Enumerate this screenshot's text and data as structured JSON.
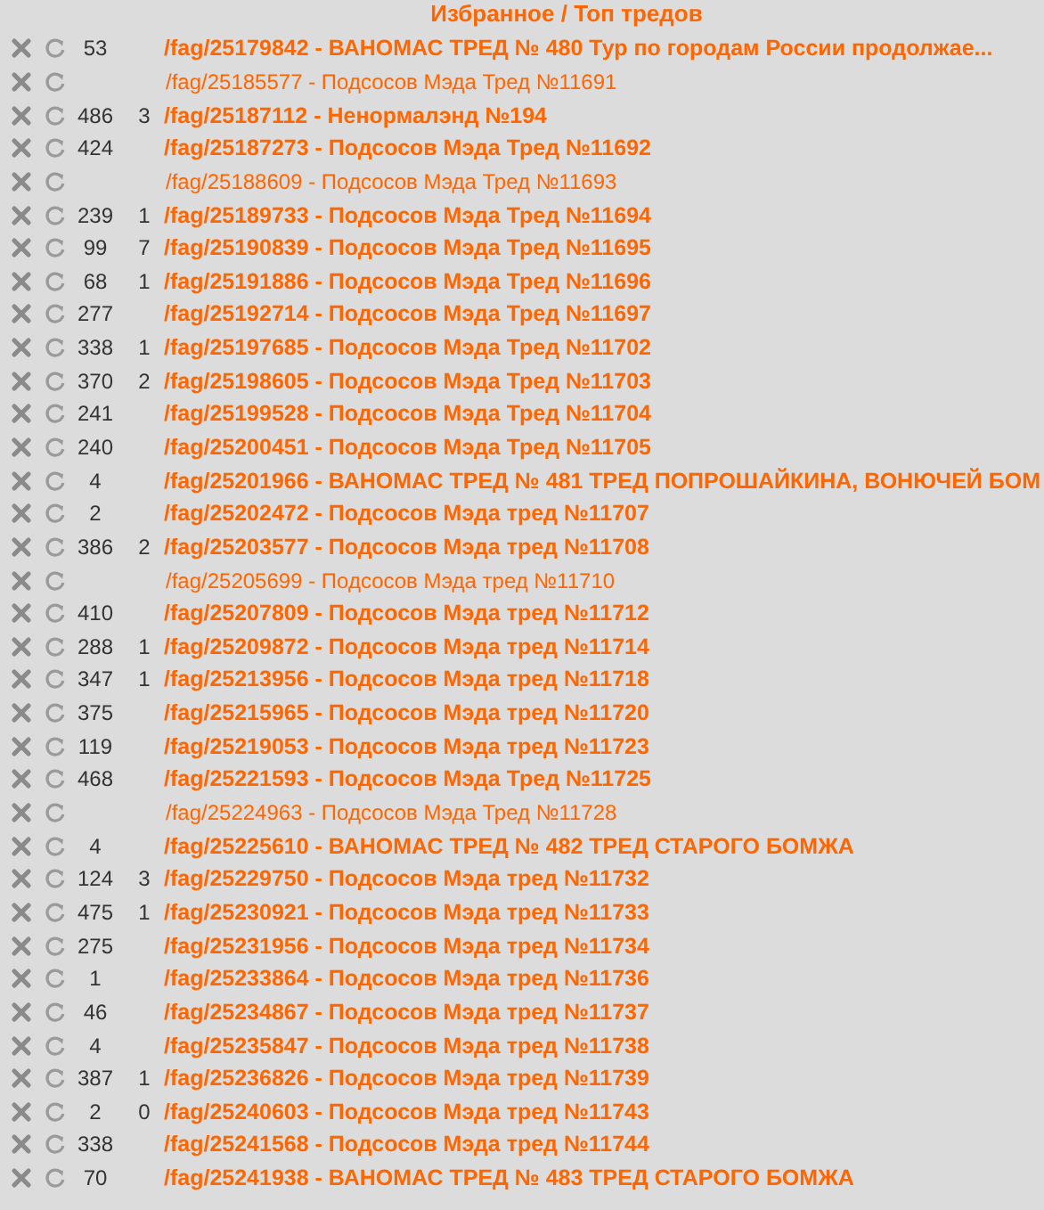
{
  "header": {
    "title": "Избранное / Топ тредов"
  },
  "threads": [
    {
      "kind": "live",
      "posts": "53",
      "link": "/fag/25179842 - ВАНОМАС ТРЕД № 480 Тур по городам России продолжае..."
    },
    {
      "kind": "dead",
      "link": "/fag/25185577 - Подсосов Мэда Тред №11691"
    },
    {
      "kind": "live",
      "posts": "486",
      "new": "3",
      "link": "/fag/25187112 - Ненормалэнд №194"
    },
    {
      "kind": "live",
      "posts": "424",
      "link": "/fag/25187273 - Подсосов Мэда Тред №11692"
    },
    {
      "kind": "dead",
      "link": "/fag/25188609 - Подсосов Мэда Тред №11693"
    },
    {
      "kind": "live",
      "posts": "239",
      "new": "1",
      "link": "/fag/25189733 - Подсосов Мэда Тред №11694"
    },
    {
      "kind": "live",
      "posts": "99",
      "new": "7",
      "link": "/fag/25190839 - Подсосов Мэда Тред №11695"
    },
    {
      "kind": "live",
      "posts": "68",
      "new": "1",
      "link": "/fag/25191886 - Подсосов Мэда Тред №11696"
    },
    {
      "kind": "live",
      "posts": "277",
      "link": "/fag/25192714 - Подсосов Мэда Тред №11697"
    },
    {
      "kind": "live",
      "posts": "338",
      "new": "1",
      "link": "/fag/25197685 - Подсосов Мэда Тред №11702"
    },
    {
      "kind": "live",
      "posts": "370",
      "new": "2",
      "link": "/fag/25198605 - Подсосов Мэда Тред №11703"
    },
    {
      "kind": "live",
      "posts": "241",
      "link": "/fag/25199528 - Подсосов Мэда Тред №11704"
    },
    {
      "kind": "live",
      "posts": "240",
      "link": "/fag/25200451 - Подсосов Мэда Тред №11705"
    },
    {
      "kind": "live",
      "posts": "4",
      "link": "/fag/25201966 - ВАНОМАС ТРЕД № 481 ТРЕД ПОПРОШАЙКИНА, ВОНЮЧЕЙ БОМ"
    },
    {
      "kind": "live",
      "posts": "2",
      "link": "/fag/25202472 - Подсосов Мэда тред №11707"
    },
    {
      "kind": "live",
      "posts": "386",
      "new": "2",
      "link": "/fag/25203577 - Подсосов Мэда тред №11708"
    },
    {
      "kind": "dead",
      "link": "/fag/25205699 - Подсосов Мэда тред №11710"
    },
    {
      "kind": "live",
      "posts": "410",
      "link": "/fag/25207809 - Подсосов Мэда тред №11712"
    },
    {
      "kind": "live",
      "posts": "288",
      "new": "1",
      "link": "/fag/25209872 - Подсосов Мэда тред №11714"
    },
    {
      "kind": "live",
      "posts": "347",
      "new": "1",
      "link": "/fag/25213956 - Подсосов Мэда тред №11718"
    },
    {
      "kind": "live",
      "posts": "375",
      "link": "/fag/25215965 - Подсосов Мэда тред №11720"
    },
    {
      "kind": "live",
      "posts": "119",
      "link": "/fag/25219053 - Подсосов Мэда тред №11723"
    },
    {
      "kind": "live",
      "posts": "468",
      "link": "/fag/25221593 - Подсосов Мэда Тред №11725"
    },
    {
      "kind": "dead",
      "link": "/fag/25224963 - Подсосов Мэда Тред №11728"
    },
    {
      "kind": "live",
      "posts": "4",
      "link": "/fag/25225610 - ВАНОМАС ТРЕД № 482 ТРЕД СТАРОГО БОМЖА"
    },
    {
      "kind": "live",
      "posts": "124",
      "new": "3",
      "link": "/fag/25229750 - Подсосов Мэда тред №11732"
    },
    {
      "kind": "live",
      "posts": "475",
      "new": "1",
      "link": "/fag/25230921 - Подсосов Мэда тред №11733"
    },
    {
      "kind": "live",
      "posts": "275",
      "link": "/fag/25231956 - Подсосов Мэда тред №11734"
    },
    {
      "kind": "live",
      "posts": "1",
      "link": "/fag/25233864 - Подсосов Мэда тред №11736"
    },
    {
      "kind": "live",
      "posts": "46",
      "link": "/fag/25234867 - Подсосов Мэда тред №11737"
    },
    {
      "kind": "live",
      "posts": "4",
      "link": "/fag/25235847 - Подсосов Мэда тред №11738"
    },
    {
      "kind": "live",
      "posts": "387",
      "new": "1",
      "link": "/fag/25236826 - Подсосов Мэда тред №11739"
    },
    {
      "kind": "live",
      "posts": "2",
      "new": "0",
      "link": "/fag/25240603 - Подсосов Мэда тред №11743"
    },
    {
      "kind": "live",
      "posts": "338",
      "link": "/fag/25241568 - Подсосов Мэда тред №11744"
    },
    {
      "kind": "live",
      "posts": "70",
      "link": "/fag/25241938 - ВАНОМАС ТРЕД № 483 ТРЕД СТАРОГО БОМЖА"
    }
  ]
}
